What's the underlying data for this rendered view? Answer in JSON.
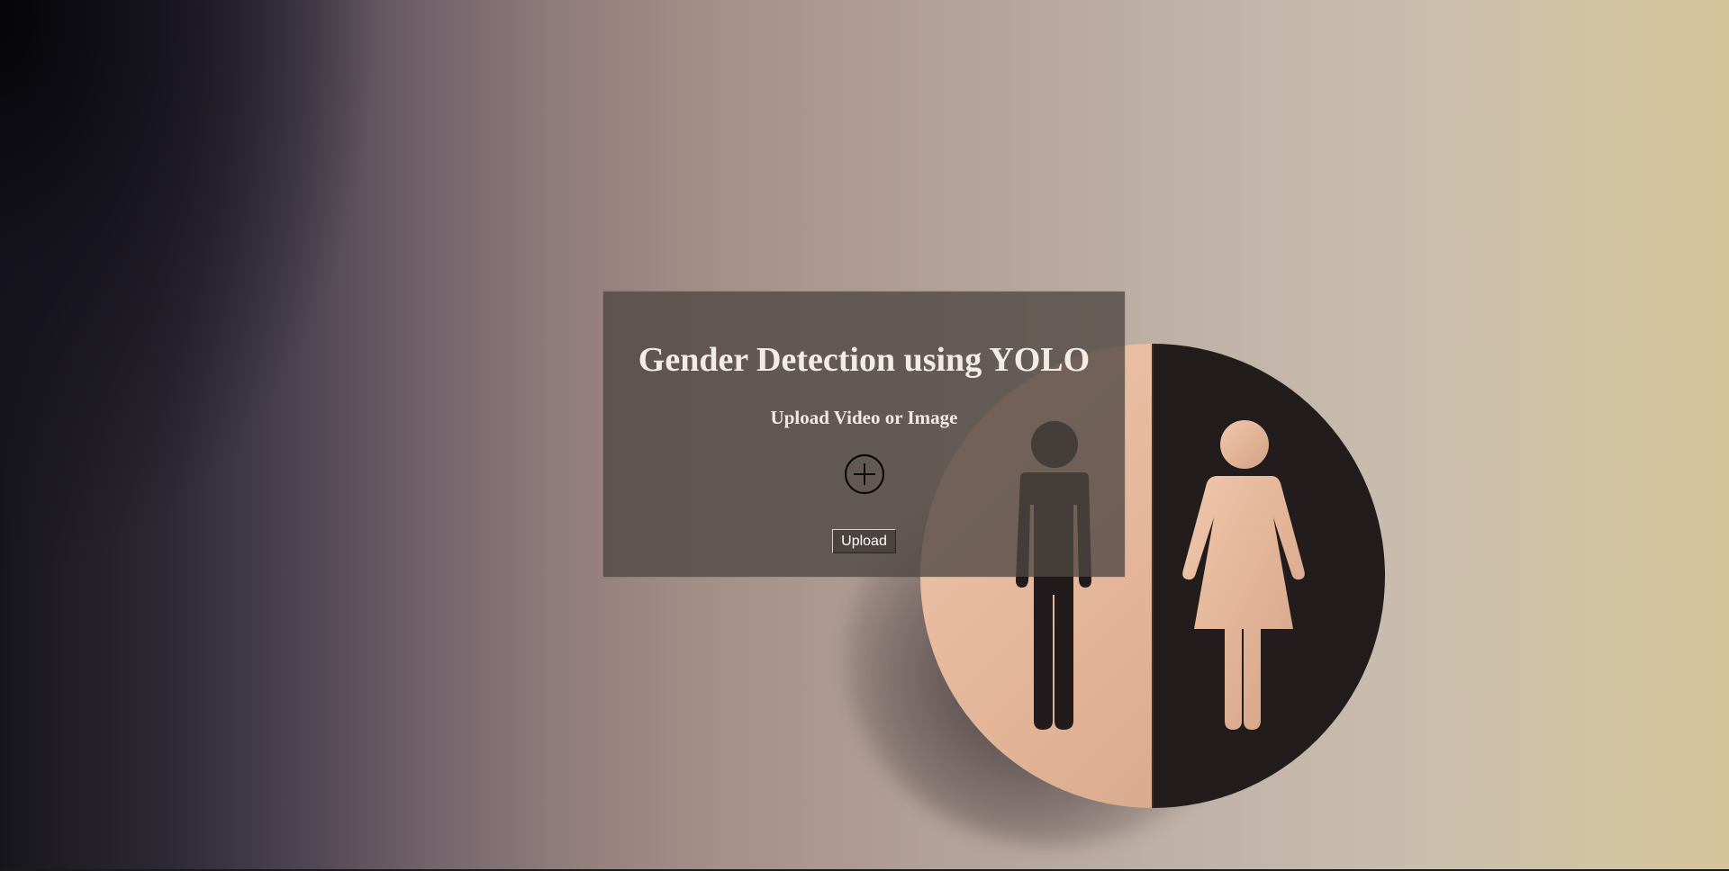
{
  "card": {
    "title": "Gender Detection using YOLO",
    "subtitle": "Upload Video or Image",
    "add_icon": "plus-circle-icon",
    "upload_label": "Upload"
  },
  "background": {
    "scene": "restroom-sign-photo",
    "sign_icons": [
      "man-icon",
      "woman-icon"
    ]
  },
  "colors": {
    "card_bg": "#4e4642",
    "title_text": "#f2ece6",
    "sign_dark": "#211c1c",
    "sign_wood": "#e4b89e"
  }
}
